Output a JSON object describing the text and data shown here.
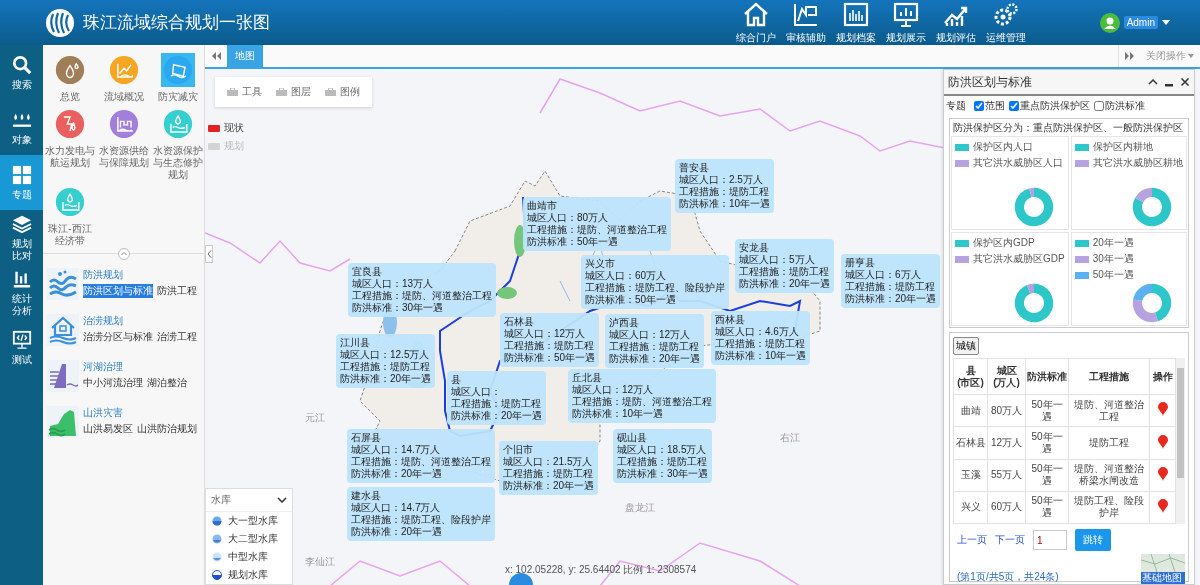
{
  "header": {
    "title": "珠江流域综合规划一张图",
    "nav": [
      {
        "label": "综合门户",
        "kind": "home"
      },
      {
        "label": "审核辅助",
        "kind": "review"
      },
      {
        "label": "规划档案",
        "kind": "archive"
      },
      {
        "label": "规划展示",
        "kind": "display"
      },
      {
        "label": "规划评估",
        "kind": "evaluate"
      },
      {
        "label": "运维管理",
        "kind": "ops"
      }
    ],
    "user": "Admin"
  },
  "sidebar": {
    "items": [
      {
        "label": "搜索",
        "kind": "search",
        "selected": false
      },
      {
        "label": "对象",
        "kind": "objects",
        "selected": false
      },
      {
        "label": "专题",
        "kind": "topics",
        "selected": true
      },
      {
        "label": "规划比对",
        "kind": "compare",
        "selected": false
      },
      {
        "label": "统计分析",
        "kind": "stats",
        "selected": false
      },
      {
        "label": "测试",
        "kind": "test",
        "selected": false
      }
    ]
  },
  "modules": [
    {
      "label": "总览",
      "kind": "drops",
      "color": "#a07e58",
      "selected": false
    },
    {
      "label": "流域概况",
      "kind": "chart",
      "color": "#f6a623",
      "selected": false
    },
    {
      "label": "防灾减灾",
      "kind": "building",
      "color": "#2aa8f0",
      "selected": true
    },
    {
      "label": "水力发电与航运规划",
      "kind": "dam",
      "color": "#e9605e",
      "selected": false
    },
    {
      "label": "水资源供给与保障规划",
      "kind": "factory",
      "color": "#a37fdc",
      "selected": false
    },
    {
      "label": "水资源保护与生态修护规划",
      "kind": "pool",
      "color": "#35cfcf",
      "selected": false
    },
    {
      "label": "珠江-西江经济带",
      "kind": "pool",
      "color": "#35cfcf",
      "selected": false
    }
  ],
  "topics": [
    {
      "title": "防洪规划",
      "kind": "flood",
      "links": [
        {
          "label": "防洪区划与标准",
          "selected": true
        },
        {
          "label": "防洪工程",
          "selected": false
        }
      ]
    },
    {
      "title": "治涝规划",
      "kind": "house",
      "links": [
        {
          "label": "治涝分区与标准",
          "selected": false
        },
        {
          "label": "治涝工程",
          "selected": false
        }
      ]
    },
    {
      "title": "河湖治理",
      "kind": "dam",
      "links": [
        {
          "label": "中小河流治理",
          "selected": false
        },
        {
          "label": "湖泊整治",
          "selected": false
        }
      ]
    },
    {
      "title": "山洪灾害",
      "kind": "mountain",
      "links": [
        {
          "label": "山洪易发区",
          "selected": false
        },
        {
          "label": "山洪防治规划",
          "selected": false
        }
      ]
    }
  ],
  "tabs": [
    {
      "label": "地图",
      "selected": true
    }
  ],
  "close_menu": "关闭操作",
  "map": {
    "toolbar": [
      "工具",
      "图层",
      "图例"
    ],
    "status_legend": [
      {
        "label": "现状",
        "color": "#e02424",
        "disabled": false
      },
      {
        "label": "规划",
        "color": "#d4d4d4",
        "disabled": true
      }
    ],
    "place_labels": [
      "元江",
      "右江",
      "盘龙江",
      "李仙江"
    ],
    "callouts": [
      {
        "name": "普安县",
        "population": "城区人口：2.5万人",
        "works": "工程措施：堤防工程",
        "standard": "防洪标准：10年一遇"
      },
      {
        "name": "曲靖市",
        "population": "城区人口：80万人",
        "works": "工程措施：堤防、河道整治工程",
        "standard": "防洪标准：50年一遇"
      },
      {
        "name": "兴义市",
        "population": "城区人口：60万人",
        "works": "工程措施：堤防工程、险段护岸",
        "standard": "防洪标准：50年一遇"
      },
      {
        "name": "安龙县",
        "population": "城区人口：5万人",
        "works": "工程措施：堤防工程",
        "standard": "防洪标准：20年一遇"
      },
      {
        "name": "册亨县",
        "population": "城区人口：6万人",
        "works": "工程措施：堤防工程",
        "standard": "防洪标准：20年一遇"
      },
      {
        "name": "宜良县",
        "population": "城区人口：13万人",
        "works": "工程措施：堤防、河道整治工程",
        "standard": "防洪标准：30年一遇"
      },
      {
        "name": "石林县",
        "population": "城区人口：12万人",
        "works": "工程措施：堤防工程",
        "standard": "防洪标准：50年一遇"
      },
      {
        "name": "泸西县",
        "population": "城区人口：12万人",
        "works": "工程措施：堤防工程",
        "standard": "防洪标准：20年一遇"
      },
      {
        "name": "西林县",
        "population": "城区人口：4.6万人",
        "works": "工程措施：堤防工程",
        "standard": "防洪标准：10年一遇"
      },
      {
        "name": "江川县",
        "population": "城区人口：12.5万人",
        "works": "工程措施：堤防工程",
        "standard": "防洪标准：20年一遇"
      },
      {
        "name": "县",
        "population": "城区人口：",
        "works": "工程措施：堤防工程",
        "standard": "防洪标准：20年一遇"
      },
      {
        "name": "丘北县",
        "population": "城区人口：12万人",
        "works": "工程措施：堤防、河道整治工程",
        "standard": "防洪标准：10年一遇"
      },
      {
        "name": "石屏县",
        "population": "城区人口：14.7万人",
        "works": "工程措施：堤防、河道整治工程",
        "standard": "防洪标准：20年一遇"
      },
      {
        "name": "砚山县",
        "population": "城区人口：18.5万人",
        "works": "工程措施：堤防工程",
        "standard": "防洪标准：30年一遇"
      },
      {
        "name": "个旧市",
        "population": "城区人口：21.5万人",
        "works": "工程措施：堤防工程",
        "standard": "防洪标准：20年一遇"
      },
      {
        "name": "建水县",
        "population": "城区人口：14.7万人",
        "works": "工程措施：堤防工程、险段护岸",
        "standard": "防洪标准：20年一遇"
      }
    ],
    "reservoir_legend": {
      "title": "水库",
      "items": [
        {
          "label": "大一型水库",
          "kind": "large1"
        },
        {
          "label": "大二型水库",
          "kind": "large2"
        },
        {
          "label": "中型水库",
          "kind": "medium"
        },
        {
          "label": "规划水库",
          "kind": "planned"
        }
      ]
    },
    "coordinates": "x: 102.05228, y: 25.64402 比例 1: 2308574"
  },
  "panel": {
    "title": "防洪区划与标准",
    "filter_label": "专题",
    "filters": [
      {
        "label": "范围",
        "checked": true
      },
      {
        "label": "重点防洪保护区",
        "checked": true
      },
      {
        "label": "防洪标准",
        "checked": false
      }
    ],
    "note": "防洪保护区分为：重点防洪保护区、一般防洪保护区",
    "charts": [
      {
        "legend": [
          {
            "label": "保护区内人口",
            "color": "#2ec7c9"
          },
          {
            "label": "其它洪水威胁区人口",
            "color": "#b6a2de"
          }
        ]
      },
      {
        "legend": [
          {
            "label": "保护区内耕地",
            "color": "#2ec7c9"
          },
          {
            "label": "其它洪水威胁区耕地",
            "color": "#b6a2de"
          }
        ]
      },
      {
        "legend": [
          {
            "label": "保护区内GDP",
            "color": "#2ec7c9"
          },
          {
            "label": "其它洪水威胁区GDP",
            "color": "#b6a2de"
          }
        ]
      },
      {
        "legend": [
          {
            "label": "20年一遇",
            "color": "#2ec7c9"
          },
          {
            "label": "30年一遇",
            "color": "#b6a2de"
          },
          {
            "label": "50年一遇",
            "color": "#5ab1ef"
          }
        ]
      }
    ],
    "table": {
      "tab": "城镇",
      "columns": [
        "县(市区)",
        "城区(万人)",
        "防洪标准",
        "工程措施",
        "操作"
      ],
      "rows": [
        [
          "曲靖",
          "80万人",
          "50年一遇",
          "堤防、河道整治工程"
        ],
        [
          "石林县",
          "12万人",
          "50年一遇",
          "堤防工程"
        ],
        [
          "玉溪",
          "55万人",
          "50年一遇",
          "堤防、河道整治桥梁水闸改造"
        ],
        [
          "兴义",
          "60万人",
          "50年一遇",
          "堤防工程、险段护岸"
        ]
      ]
    },
    "pager": {
      "prev": "上一页",
      "next": "下一页",
      "page": "1",
      "go": "跳转",
      "info": "(第1页/共5页，共24条)"
    },
    "basemap": "基础地图"
  }
}
